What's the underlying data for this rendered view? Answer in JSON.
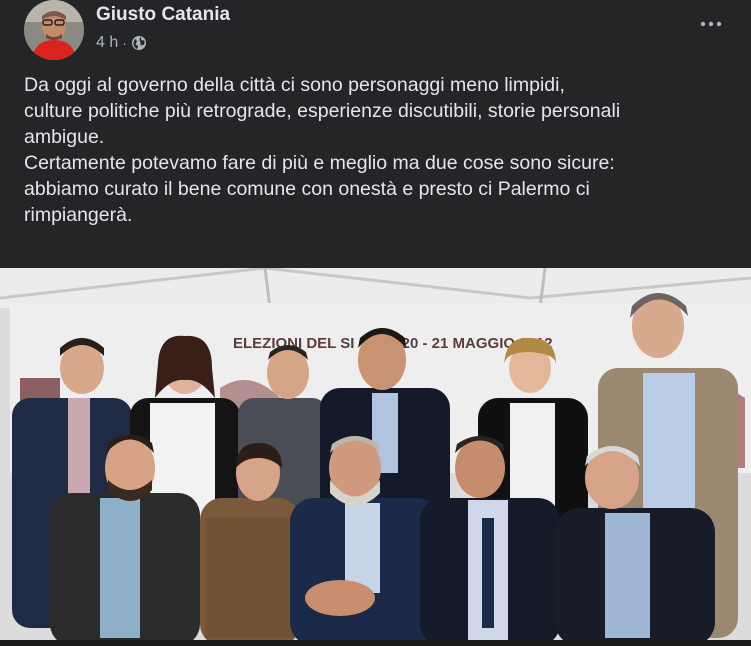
{
  "post": {
    "author": "Giusto Catania",
    "time": "4 h",
    "separator": "·",
    "audience_icon": "globe-icon",
    "menu_icon": "more-horizontal-icon",
    "message": [
      "Da oggi al governo della città ci sono personaggi meno limpidi,",
      "culture politiche più retrograde, esperienze discutibili, storie personali",
      "ambigue.",
      "Certamente potevamo fare di più e meglio ma due cose sono sicure:",
      "abbiamo curato il bene comune con onestà e presto ci Palermo ci",
      "rimpiangerà."
    ]
  },
  "photo": {
    "banner_text": "ELEZIONI DEL SI",
    "banner_text_2": "CO 20 - 21 MAGGIO 2012"
  },
  "colors": {
    "background": "#242526",
    "text_primary": "#e4e6eb",
    "text_secondary": "#b0b3b8"
  }
}
